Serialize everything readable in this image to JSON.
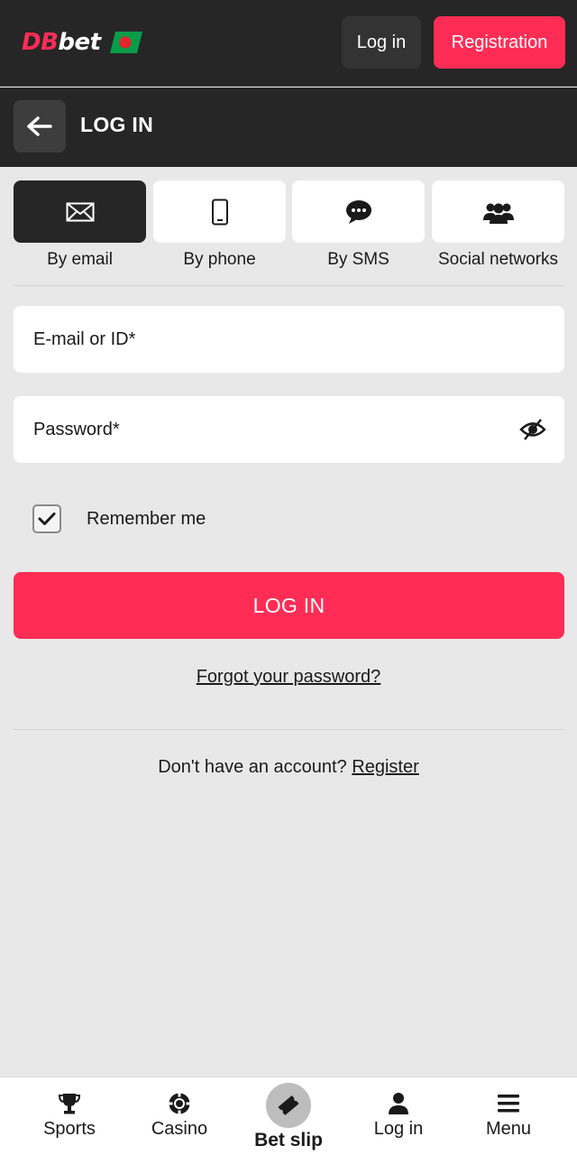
{
  "header": {
    "logo_text_a": "DB",
    "logo_text_b": "bet",
    "login_label": "Log in",
    "register_label": "Registration"
  },
  "title_bar": {
    "title": "LOG IN"
  },
  "methods": [
    {
      "label": "By email",
      "icon": "envelope-icon",
      "active": true
    },
    {
      "label": "By phone",
      "icon": "phone-icon",
      "active": false
    },
    {
      "label": "By SMS",
      "icon": "chat-bubble-icon",
      "active": false
    },
    {
      "label": "Social networks",
      "icon": "users-icon",
      "active": false
    }
  ],
  "form": {
    "email_placeholder": "E-mail or ID*",
    "password_placeholder": "Password*",
    "remember_label": "Remember me",
    "remember_checked": true,
    "submit_label": "LOG IN",
    "forgot_label": "Forgot your password?",
    "no_account_text": "Don't have an account?",
    "register_link": "Register"
  },
  "bottom_nav": [
    {
      "label": "Sports",
      "icon": "trophy-icon"
    },
    {
      "label": "Casino",
      "icon": "casino-chip-icon"
    },
    {
      "label": "Bet slip",
      "icon": "ticket-icon"
    },
    {
      "label": "Log in",
      "icon": "user-icon"
    },
    {
      "label": "Menu",
      "icon": "hamburger-icon"
    }
  ],
  "colors": {
    "accent": "#ff2d55",
    "header_bg": "#262626",
    "page_bg": "#e8e8e8"
  }
}
